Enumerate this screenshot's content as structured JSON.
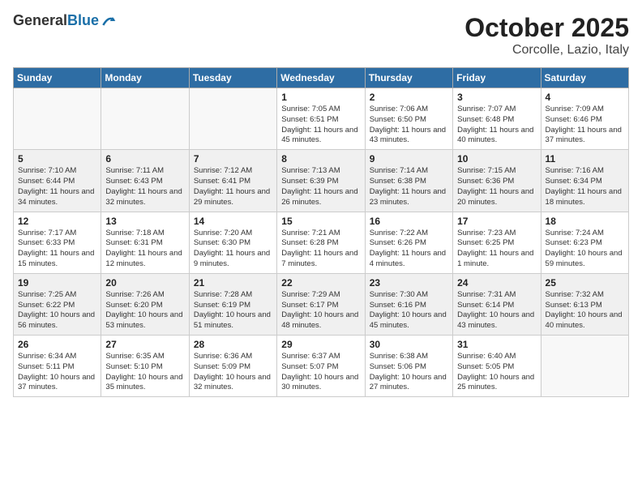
{
  "logo": {
    "general": "General",
    "blue": "Blue"
  },
  "header": {
    "month": "October 2025",
    "location": "Corcolle, Lazio, Italy"
  },
  "days_of_week": [
    "Sunday",
    "Monday",
    "Tuesday",
    "Wednesday",
    "Thursday",
    "Friday",
    "Saturday"
  ],
  "weeks": [
    [
      {
        "day": "",
        "info": ""
      },
      {
        "day": "",
        "info": ""
      },
      {
        "day": "",
        "info": ""
      },
      {
        "day": "1",
        "info": "Sunrise: 7:05 AM\nSunset: 6:51 PM\nDaylight: 11 hours and 45 minutes."
      },
      {
        "day": "2",
        "info": "Sunrise: 7:06 AM\nSunset: 6:50 PM\nDaylight: 11 hours and 43 minutes."
      },
      {
        "day": "3",
        "info": "Sunrise: 7:07 AM\nSunset: 6:48 PM\nDaylight: 11 hours and 40 minutes."
      },
      {
        "day": "4",
        "info": "Sunrise: 7:09 AM\nSunset: 6:46 PM\nDaylight: 11 hours and 37 minutes."
      }
    ],
    [
      {
        "day": "5",
        "info": "Sunrise: 7:10 AM\nSunset: 6:44 PM\nDaylight: 11 hours and 34 minutes."
      },
      {
        "day": "6",
        "info": "Sunrise: 7:11 AM\nSunset: 6:43 PM\nDaylight: 11 hours and 32 minutes."
      },
      {
        "day": "7",
        "info": "Sunrise: 7:12 AM\nSunset: 6:41 PM\nDaylight: 11 hours and 29 minutes."
      },
      {
        "day": "8",
        "info": "Sunrise: 7:13 AM\nSunset: 6:39 PM\nDaylight: 11 hours and 26 minutes."
      },
      {
        "day": "9",
        "info": "Sunrise: 7:14 AM\nSunset: 6:38 PM\nDaylight: 11 hours and 23 minutes."
      },
      {
        "day": "10",
        "info": "Sunrise: 7:15 AM\nSunset: 6:36 PM\nDaylight: 11 hours and 20 minutes."
      },
      {
        "day": "11",
        "info": "Sunrise: 7:16 AM\nSunset: 6:34 PM\nDaylight: 11 hours and 18 minutes."
      }
    ],
    [
      {
        "day": "12",
        "info": "Sunrise: 7:17 AM\nSunset: 6:33 PM\nDaylight: 11 hours and 15 minutes."
      },
      {
        "day": "13",
        "info": "Sunrise: 7:18 AM\nSunset: 6:31 PM\nDaylight: 11 hours and 12 minutes."
      },
      {
        "day": "14",
        "info": "Sunrise: 7:20 AM\nSunset: 6:30 PM\nDaylight: 11 hours and 9 minutes."
      },
      {
        "day": "15",
        "info": "Sunrise: 7:21 AM\nSunset: 6:28 PM\nDaylight: 11 hours and 7 minutes."
      },
      {
        "day": "16",
        "info": "Sunrise: 7:22 AM\nSunset: 6:26 PM\nDaylight: 11 hours and 4 minutes."
      },
      {
        "day": "17",
        "info": "Sunrise: 7:23 AM\nSunset: 6:25 PM\nDaylight: 11 hours and 1 minute."
      },
      {
        "day": "18",
        "info": "Sunrise: 7:24 AM\nSunset: 6:23 PM\nDaylight: 10 hours and 59 minutes."
      }
    ],
    [
      {
        "day": "19",
        "info": "Sunrise: 7:25 AM\nSunset: 6:22 PM\nDaylight: 10 hours and 56 minutes."
      },
      {
        "day": "20",
        "info": "Sunrise: 7:26 AM\nSunset: 6:20 PM\nDaylight: 10 hours and 53 minutes."
      },
      {
        "day": "21",
        "info": "Sunrise: 7:28 AM\nSunset: 6:19 PM\nDaylight: 10 hours and 51 minutes."
      },
      {
        "day": "22",
        "info": "Sunrise: 7:29 AM\nSunset: 6:17 PM\nDaylight: 10 hours and 48 minutes."
      },
      {
        "day": "23",
        "info": "Sunrise: 7:30 AM\nSunset: 6:16 PM\nDaylight: 10 hours and 45 minutes."
      },
      {
        "day": "24",
        "info": "Sunrise: 7:31 AM\nSunset: 6:14 PM\nDaylight: 10 hours and 43 minutes."
      },
      {
        "day": "25",
        "info": "Sunrise: 7:32 AM\nSunset: 6:13 PM\nDaylight: 10 hours and 40 minutes."
      }
    ],
    [
      {
        "day": "26",
        "info": "Sunrise: 6:34 AM\nSunset: 5:11 PM\nDaylight: 10 hours and 37 minutes."
      },
      {
        "day": "27",
        "info": "Sunrise: 6:35 AM\nSunset: 5:10 PM\nDaylight: 10 hours and 35 minutes."
      },
      {
        "day": "28",
        "info": "Sunrise: 6:36 AM\nSunset: 5:09 PM\nDaylight: 10 hours and 32 minutes."
      },
      {
        "day": "29",
        "info": "Sunrise: 6:37 AM\nSunset: 5:07 PM\nDaylight: 10 hours and 30 minutes."
      },
      {
        "day": "30",
        "info": "Sunrise: 6:38 AM\nSunset: 5:06 PM\nDaylight: 10 hours and 27 minutes."
      },
      {
        "day": "31",
        "info": "Sunrise: 6:40 AM\nSunset: 5:05 PM\nDaylight: 10 hours and 25 minutes."
      },
      {
        "day": "",
        "info": ""
      }
    ]
  ]
}
